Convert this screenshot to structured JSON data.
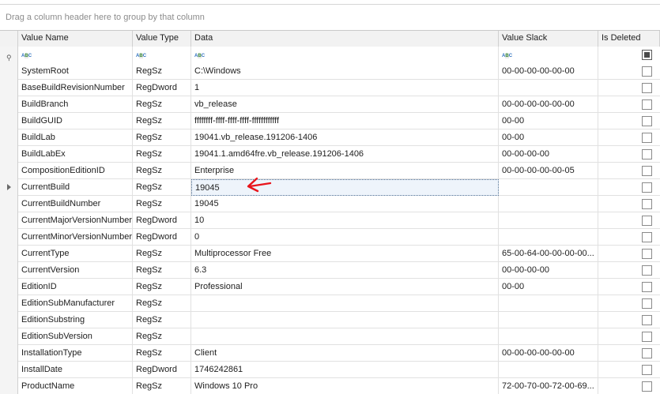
{
  "group_panel_text": "Drag a column header here to group by that column",
  "columns": [
    "Value Name",
    "Value Type",
    "Data",
    "Value Slack",
    "Is Deleted"
  ],
  "filter_icon": "abc-filter-icon",
  "rows": [
    {
      "name": "SystemRoot",
      "type": "RegSz",
      "data": "C:\\Windows",
      "slack": "00-00-00-00-00-00"
    },
    {
      "name": "BaseBuildRevisionNumber",
      "type": "RegDword",
      "data": "1",
      "slack": ""
    },
    {
      "name": "BuildBranch",
      "type": "RegSz",
      "data": "vb_release",
      "slack": "00-00-00-00-00-00"
    },
    {
      "name": "BuildGUID",
      "type": "RegSz",
      "data": "ffffffff-ffff-ffff-ffff-ffffffffffff",
      "slack": "00-00"
    },
    {
      "name": "BuildLab",
      "type": "RegSz",
      "data": "19041.vb_release.191206-1406",
      "slack": "00-00"
    },
    {
      "name": "BuildLabEx",
      "type": "RegSz",
      "data": "19041.1.amd64fre.vb_release.191206-1406",
      "slack": "00-00-00-00"
    },
    {
      "name": "CompositionEditionID",
      "type": "RegSz",
      "data": "Enterprise",
      "slack": "00-00-00-00-00-05"
    },
    {
      "name": "CurrentBuild",
      "type": "RegSz",
      "data": "19045",
      "slack": ""
    },
    {
      "name": "CurrentBuildNumber",
      "type": "RegSz",
      "data": "19045",
      "slack": ""
    },
    {
      "name": "CurrentMajorVersionNumber",
      "type": "RegDword",
      "data": "10",
      "slack": ""
    },
    {
      "name": "CurrentMinorVersionNumber",
      "type": "RegDword",
      "data": "0",
      "slack": ""
    },
    {
      "name": "CurrentType",
      "type": "RegSz",
      "data": "Multiprocessor Free",
      "slack": "65-00-64-00-00-00-00..."
    },
    {
      "name": "CurrentVersion",
      "type": "RegSz",
      "data": "6.3",
      "slack": "00-00-00-00"
    },
    {
      "name": "EditionID",
      "type": "RegSz",
      "data": "Professional",
      "slack": "00-00"
    },
    {
      "name": "EditionSubManufacturer",
      "type": "RegSz",
      "data": "",
      "slack": ""
    },
    {
      "name": "EditionSubstring",
      "type": "RegSz",
      "data": "",
      "slack": ""
    },
    {
      "name": "EditionSubVersion",
      "type": "RegSz",
      "data": "",
      "slack": ""
    },
    {
      "name": "InstallationType",
      "type": "RegSz",
      "data": "Client",
      "slack": "00-00-00-00-00-00"
    },
    {
      "name": "InstallDate",
      "type": "RegDword",
      "data": "1746242861",
      "slack": ""
    },
    {
      "name": "ProductName",
      "type": "RegSz",
      "data": "Windows 10 Pro",
      "slack": "72-00-70-00-72-00-69..."
    }
  ],
  "focused_row_index": 7,
  "annotation_color": "#e8141b"
}
